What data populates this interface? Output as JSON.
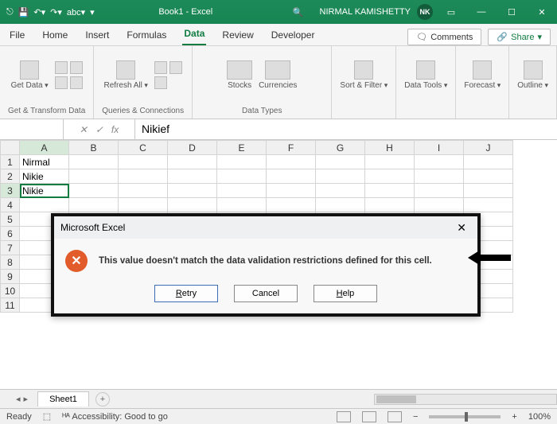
{
  "titlebar": {
    "autosave": "",
    "docname": "Book1 - Excel",
    "username": "NIRMAL KAMISHETTY",
    "avatar": "NK"
  },
  "tabs": {
    "file": "File",
    "home": "Home",
    "insert": "Insert",
    "formulas": "Formulas",
    "data": "Data",
    "review": "Review",
    "developer": "Developer",
    "comments": "Comments",
    "share": "Share"
  },
  "ribbon": {
    "group1": {
      "btn": "Get Data",
      "label": "Get & Transform Data"
    },
    "group2": {
      "btn": "Refresh All",
      "label": "Queries & Connections"
    },
    "group3": {
      "btn1": "Stocks",
      "btn2": "Currencies",
      "label": "Data Types"
    },
    "group4": {
      "btn": "Sort & Filter"
    },
    "group5": {
      "btn": "Data Tools"
    },
    "group6": {
      "btn": "Forecast"
    },
    "group7": {
      "btn": "Outline"
    }
  },
  "formulabar": {
    "namebox": "",
    "fx": "fx",
    "value": "Nikief"
  },
  "columns": [
    "A",
    "B",
    "C",
    "D",
    "E",
    "F",
    "G",
    "H",
    "I",
    "J"
  ],
  "rows": [
    "1",
    "2",
    "3",
    "4",
    "5",
    "6",
    "7",
    "8",
    "9",
    "10",
    "11"
  ],
  "cells": {
    "A1": "Nirmal",
    "A2": "Nikie",
    "A3": "Nikie"
  },
  "dialog": {
    "title": "Microsoft Excel",
    "message": "This value doesn't match the data validation restrictions defined for this cell.",
    "retry": "etry",
    "retry_prefix": "R",
    "cancel": "Cancel",
    "help": "elp",
    "help_prefix": "H"
  },
  "sheettabs": {
    "sheet1": "Sheet1",
    "add": "+"
  },
  "statusbar": {
    "mode": "Ready",
    "access": "Accessibility: Good to go",
    "zoom": "100%"
  }
}
